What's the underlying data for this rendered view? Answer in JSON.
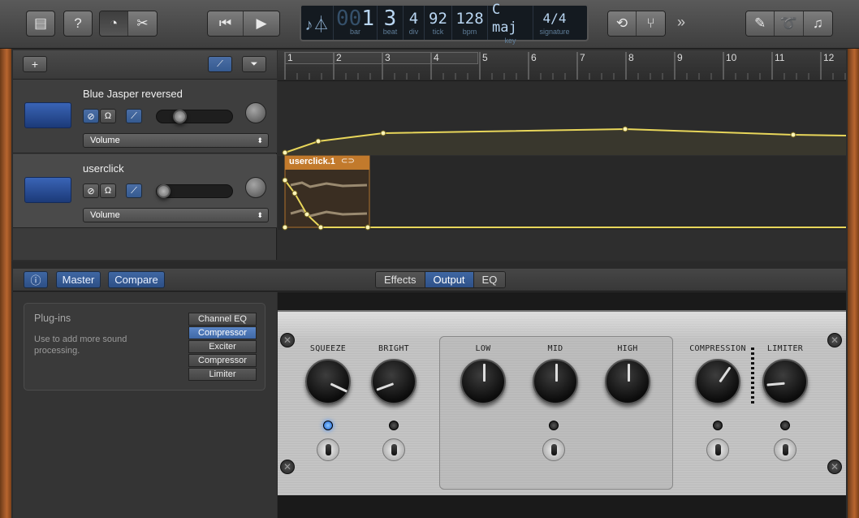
{
  "lcd": {
    "bar_dim": "00",
    "bar": "1",
    "bar_label": "bar",
    "beat": "3",
    "beat_label": "beat",
    "div": "4",
    "div_label": "div",
    "tick": "92",
    "tick_label": "tick",
    "bpm": "128",
    "bpm_label": "bpm",
    "key": "C maj",
    "key_label": "key",
    "signature": "4/4",
    "signature_label": "signature"
  },
  "toolbar": {
    "more_glyph": "»"
  },
  "ruler": {
    "bars": [
      "1",
      "2",
      "3",
      "4",
      "5",
      "6",
      "7",
      "8",
      "9",
      "10",
      "11",
      "12"
    ]
  },
  "tracks": [
    {
      "name": "Blue Jasper reversed",
      "automation": "Volume",
      "volume_level": 0.25
    },
    {
      "name": "userclick",
      "automation": "Volume",
      "volume_level": 0.0
    }
  ],
  "region": {
    "name": "userclick.1"
  },
  "lower": {
    "master": "Master",
    "compare": "Compare",
    "tabs": [
      "Effects",
      "Output",
      "EQ"
    ],
    "active_tab": "Output"
  },
  "plugins": {
    "title": "Plug-ins",
    "description": "Use to add more sound processing.",
    "slots": [
      "Channel EQ",
      "Compressor",
      "Exciter",
      "Compressor",
      "Limiter"
    ],
    "active_slot": "Compressor"
  },
  "amp": {
    "knobs": [
      "SQUEEZE",
      "BRIGHT",
      "LOW",
      "MID",
      "HIGH",
      "COMPRESSION",
      "LIMITER"
    ]
  }
}
